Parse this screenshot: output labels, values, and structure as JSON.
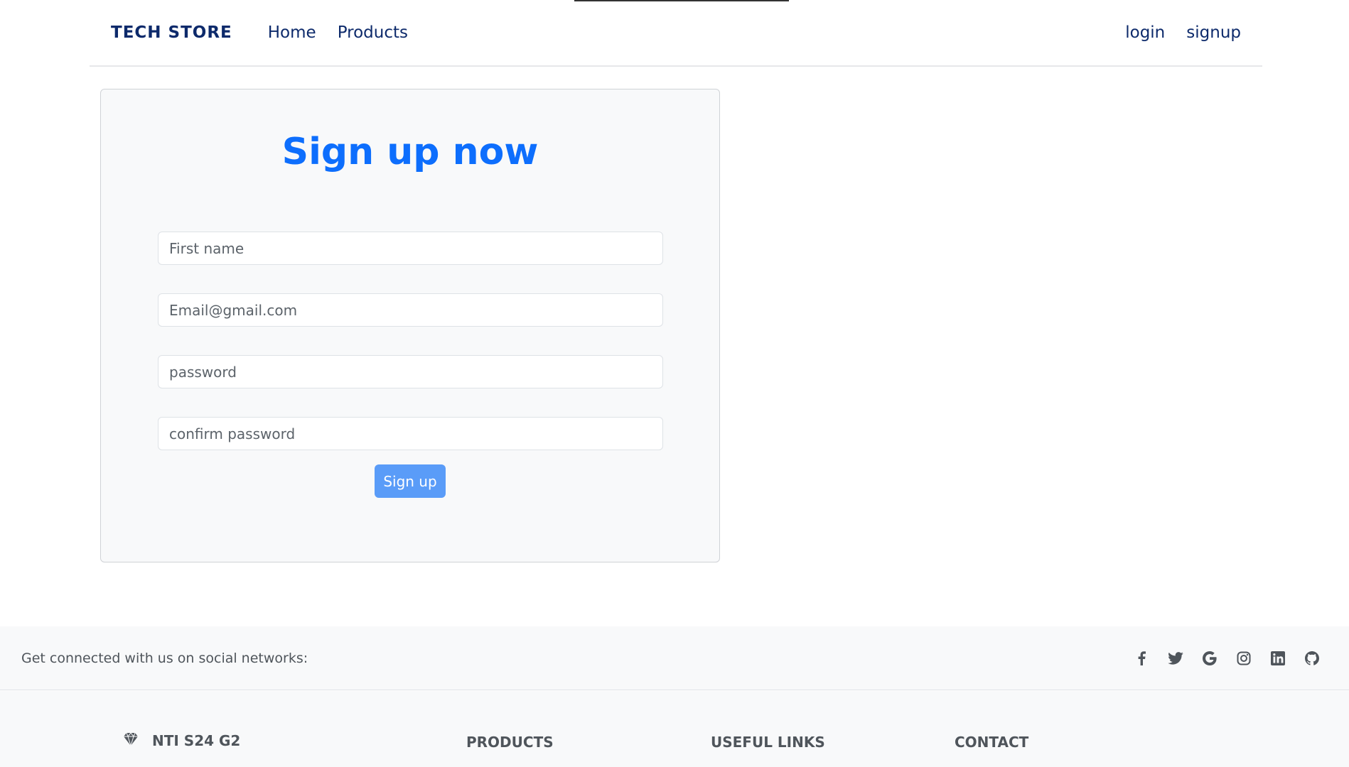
{
  "navbar": {
    "brand": "TECH STORE",
    "links": [
      "Home",
      "Products"
    ],
    "right_links": [
      "login",
      "signup"
    ]
  },
  "signup": {
    "title": "Sign up now",
    "fields": {
      "first_name": {
        "placeholder": "First name"
      },
      "email": {
        "placeholder": "Email@gmail.com"
      },
      "password": {
        "placeholder": "password"
      },
      "confirm_password": {
        "placeholder": "confirm password"
      }
    },
    "button_label": "Sign up"
  },
  "footer": {
    "social_text": "Get connected with us on social networks:",
    "social_icons": [
      "facebook-icon",
      "twitter-icon",
      "google-icon",
      "instagram-icon",
      "linkedin-icon",
      "github-icon"
    ],
    "brand": "NTI S24 G2",
    "headings": [
      "PRODUCTS",
      "USEFUL LINKS",
      "CONTACT"
    ]
  },
  "colors": {
    "primary": "#0d6efd",
    "button": "#5a9cf8",
    "navy": "#0d2a6b",
    "footer_bg": "#f8f9fa",
    "muted_text": "#4f555b"
  }
}
